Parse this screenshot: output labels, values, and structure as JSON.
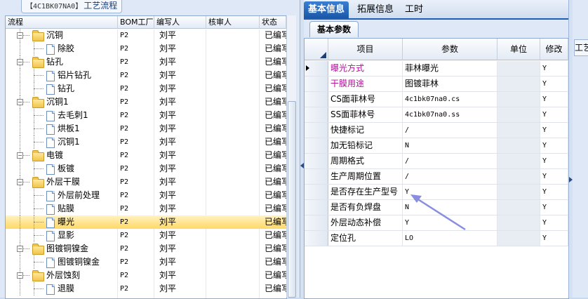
{
  "left": {
    "tab_code": "【4C1BK07NA0】",
    "tab_title": "工艺流程",
    "columns": [
      "流程",
      "BOM工厂",
      "编写人",
      "核审人",
      "状态"
    ],
    "rows": [
      {
        "label": "沉铜",
        "level": 1,
        "type": "folder",
        "bom": "P2",
        "writer": "刘平",
        "reviewer": "",
        "status": "已编写"
      },
      {
        "label": "除胶",
        "level": 2,
        "type": "doc",
        "bom": "P2",
        "writer": "刘平",
        "reviewer": "",
        "status": "已编写"
      },
      {
        "label": "钻孔",
        "level": 1,
        "type": "folder",
        "bom": "P2",
        "writer": "刘平",
        "reviewer": "",
        "status": "已编写"
      },
      {
        "label": "铝片钻孔",
        "level": 2,
        "type": "doc",
        "bom": "P2",
        "writer": "刘平",
        "reviewer": "",
        "status": "已编写"
      },
      {
        "label": "钻孔",
        "level": 2,
        "type": "doc",
        "bom": "P2",
        "writer": "刘平",
        "reviewer": "",
        "status": "已编写"
      },
      {
        "label": "沉铜1",
        "level": 1,
        "type": "folder",
        "bom": "P2",
        "writer": "刘平",
        "reviewer": "",
        "status": "已编写"
      },
      {
        "label": "去毛刺1",
        "level": 2,
        "type": "doc",
        "bom": "P2",
        "writer": "刘平",
        "reviewer": "",
        "status": "已编写"
      },
      {
        "label": "烘板1",
        "level": 2,
        "type": "doc",
        "bom": "P2",
        "writer": "刘平",
        "reviewer": "",
        "status": "已编写"
      },
      {
        "label": "沉铜1",
        "level": 2,
        "type": "doc",
        "bom": "P2",
        "writer": "刘平",
        "reviewer": "",
        "status": "已编写"
      },
      {
        "label": "电镀",
        "level": 1,
        "type": "folder",
        "bom": "P2",
        "writer": "刘平",
        "reviewer": "",
        "status": "已编写"
      },
      {
        "label": "板镀",
        "level": 2,
        "type": "doc",
        "bom": "P2",
        "writer": "刘平",
        "reviewer": "",
        "status": "已编写"
      },
      {
        "label": "外层干膜",
        "level": 1,
        "type": "folder",
        "bom": "P2",
        "writer": "刘平",
        "reviewer": "",
        "status": "已编写"
      },
      {
        "label": "外层前处理",
        "level": 2,
        "type": "doc",
        "bom": "P2",
        "writer": "刘平",
        "reviewer": "",
        "status": "已编写"
      },
      {
        "label": "贴膜",
        "level": 2,
        "type": "doc",
        "bom": "P2",
        "writer": "刘平",
        "reviewer": "",
        "status": "已编写"
      },
      {
        "label": "曝光",
        "level": 2,
        "type": "doc",
        "bom": "P2",
        "writer": "刘平",
        "reviewer": "",
        "status": "已编写",
        "selected": true
      },
      {
        "label": "显影",
        "level": 2,
        "type": "doc",
        "bom": "P2",
        "writer": "刘平",
        "reviewer": "",
        "status": "已编写"
      },
      {
        "label": "图镀铜镍金",
        "level": 1,
        "type": "folder",
        "bom": "P2",
        "writer": "刘平",
        "reviewer": "",
        "status": "已编写"
      },
      {
        "label": "图镀铜镍金",
        "level": 2,
        "type": "doc",
        "bom": "P2",
        "writer": "刘平",
        "reviewer": "",
        "status": "已编写"
      },
      {
        "label": "外层蚀刻",
        "level": 1,
        "type": "folder",
        "bom": "P2",
        "writer": "刘平",
        "reviewer": "",
        "status": "已编写"
      },
      {
        "label": "退膜",
        "level": 2,
        "type": "doc",
        "bom": "P2",
        "writer": "刘平",
        "reviewer": "",
        "status": "已编写"
      }
    ]
  },
  "right": {
    "tabs": [
      "基本信息",
      "拓展信息",
      "工时"
    ],
    "active_tab": "基本信息",
    "sub_tab": "基本参数",
    "columns": [
      "项目",
      "参数",
      "单位",
      "修改"
    ],
    "rows": [
      {
        "item": "曝光方式",
        "param": "菲林曝光",
        "unit": "",
        "modify": "Y",
        "highlight": true,
        "current": true
      },
      {
        "item": "干膜用途",
        "param": "图镀菲林",
        "unit": "",
        "modify": "Y",
        "highlight": true
      },
      {
        "item": "CS面菲林号",
        "param": "4c1bk07na0.cs",
        "unit": "",
        "modify": "Y"
      },
      {
        "item": "SS面菲林号",
        "param": "4c1bk07na0.ss",
        "unit": "",
        "modify": "Y"
      },
      {
        "item": "快捷标记",
        "param": "/",
        "unit": "",
        "modify": "Y"
      },
      {
        "item": "加无铅标记",
        "param": "N",
        "unit": "",
        "modify": "Y"
      },
      {
        "item": "周期格式",
        "param": "/",
        "unit": "",
        "modify": "Y"
      },
      {
        "item": "生产周期位置",
        "param": "/",
        "unit": "",
        "modify": "Y"
      },
      {
        "item": "是否存在生产型号",
        "param": "Y",
        "unit": "",
        "modify": "Y"
      },
      {
        "item": "是否有负焊盘",
        "param": "N",
        "unit": "",
        "modify": "Y"
      },
      {
        "item": "外层动态补偿",
        "param": "Y",
        "unit": "",
        "modify": "Y"
      },
      {
        "item": "定位孔",
        "param": "LO",
        "unit": "",
        "modify": "Y"
      }
    ],
    "far_right_tab": "工艺"
  },
  "colors": {
    "highlight_text": "#b0129a",
    "annotation_arrow": "#8a8ee0",
    "active_tab": "#1a57a8",
    "selected_row": "#ffd867"
  }
}
